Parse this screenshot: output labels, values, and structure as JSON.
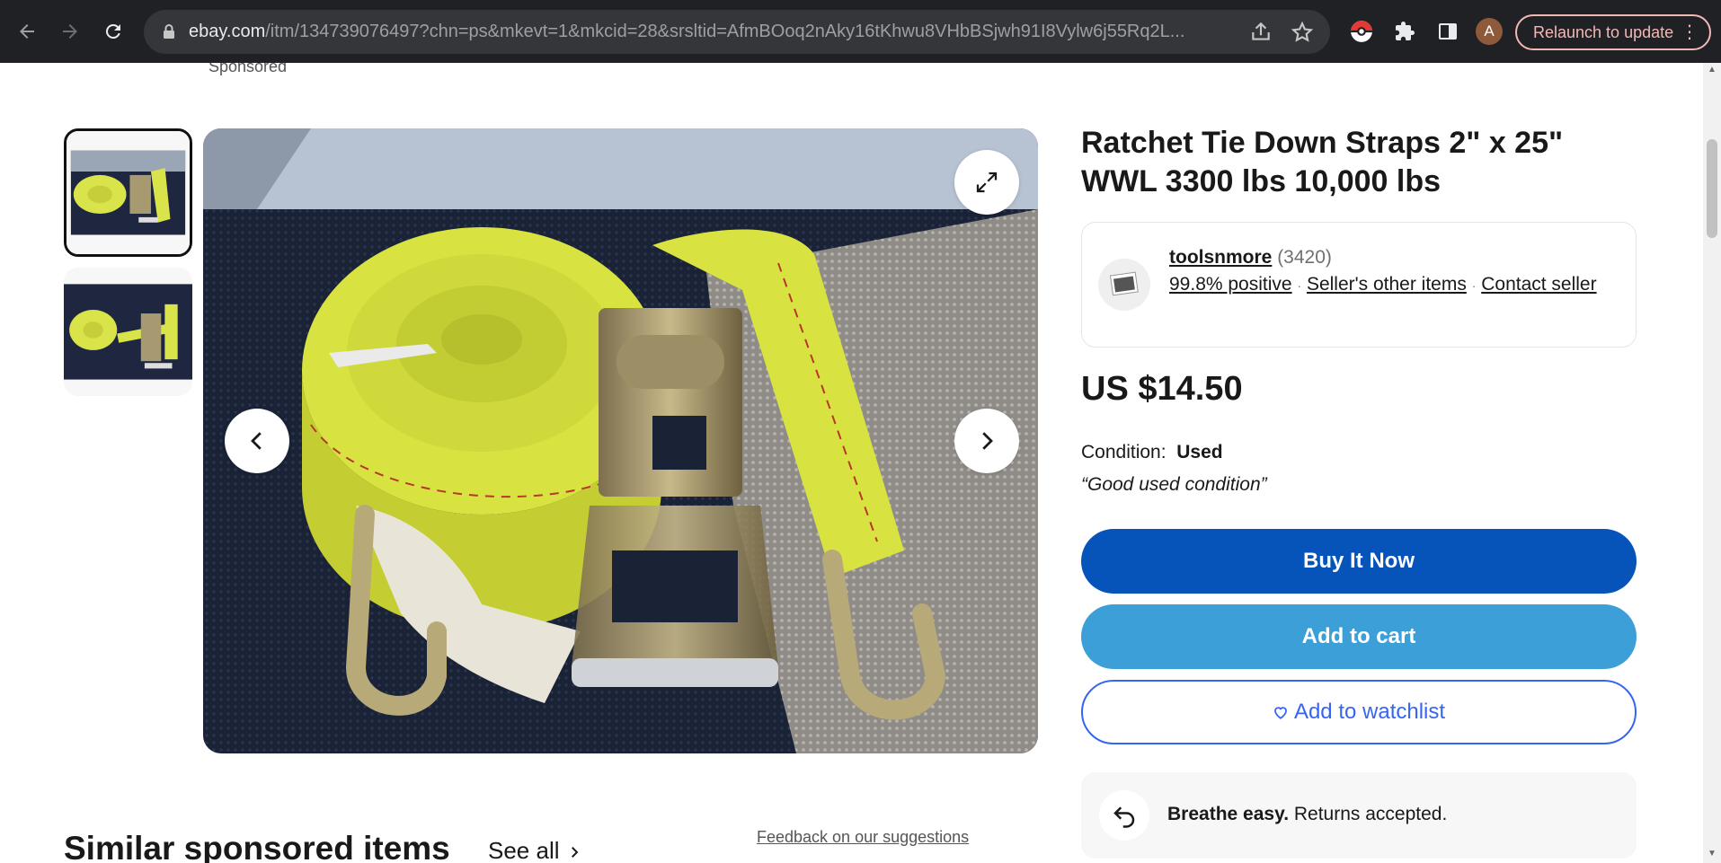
{
  "browser": {
    "url_host": "ebay.com",
    "url_path": "/itm/134739076497?chn=ps&mkevt=1&mkcid=28&srsltid=AfmBOoq2nAky16tKhwu8VHbBSjwh91I8Vylw6j55Rq2L...",
    "relaunch_label": "Relaunch to update",
    "avatar_letter": "A"
  },
  "page": {
    "sponsored_label": "Sponsored"
  },
  "listing": {
    "title": "Ratchet Tie Down Straps 2\" x 25\" WWL 3300 lbs 10,000 lbs",
    "seller": {
      "name": "toolsnmore",
      "feedback_count": "(3420)",
      "positive": "99.8% positive",
      "other_items": "Seller's other items",
      "contact": "Contact seller",
      "separator": "·"
    },
    "price": "US $14.50",
    "condition_label": "Condition:",
    "condition_value": "Used",
    "condition_note": "“Good used condition”",
    "buy_now": "Buy It Now",
    "add_to_cart": "Add to cart",
    "add_to_watchlist": "Add to watchlist",
    "returns_bold": "Breathe easy.",
    "returns_text": " Returns accepted."
  },
  "similar": {
    "heading": "Similar sponsored items",
    "see_all": "See all",
    "feedback_link": "Feedback on our suggestions"
  },
  "colors": {
    "chrome_bg": "#202124",
    "buy_now_bg": "#0654ba",
    "add_to_cart_bg": "#3d9fd8",
    "watchlist_border": "#3665f3"
  }
}
